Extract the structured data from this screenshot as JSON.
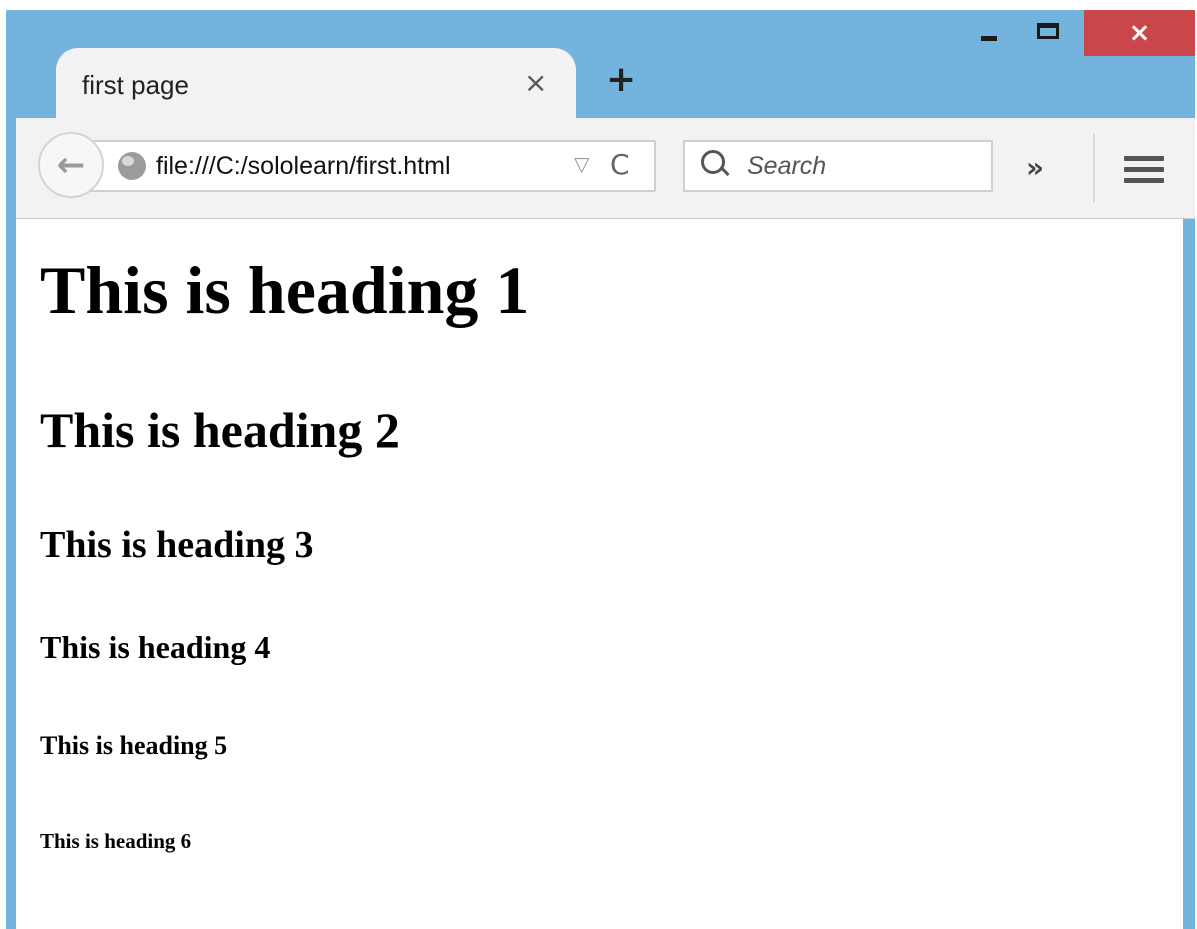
{
  "window": {
    "controls": {
      "minimize": "minimize",
      "maximize": "maximize",
      "close": "×"
    }
  },
  "tab": {
    "title": "first page",
    "close": "×",
    "new_tab": "+"
  },
  "toolbar": {
    "back": "←",
    "url": "file:///C:/sololearn/first.html",
    "dropdown": "▽",
    "reload": "C",
    "search_placeholder": "Search",
    "overflow": "»"
  },
  "content": {
    "h1": "This is heading 1",
    "h2": "This is heading 2",
    "h3": "This is heading 3",
    "h4": "This is heading 4",
    "h5": "This is heading 5",
    "h6": "This is heading 6"
  },
  "colors": {
    "frame": "#74b3de",
    "close_button": "#c9464a",
    "toolbar": "#f2f2f2"
  }
}
